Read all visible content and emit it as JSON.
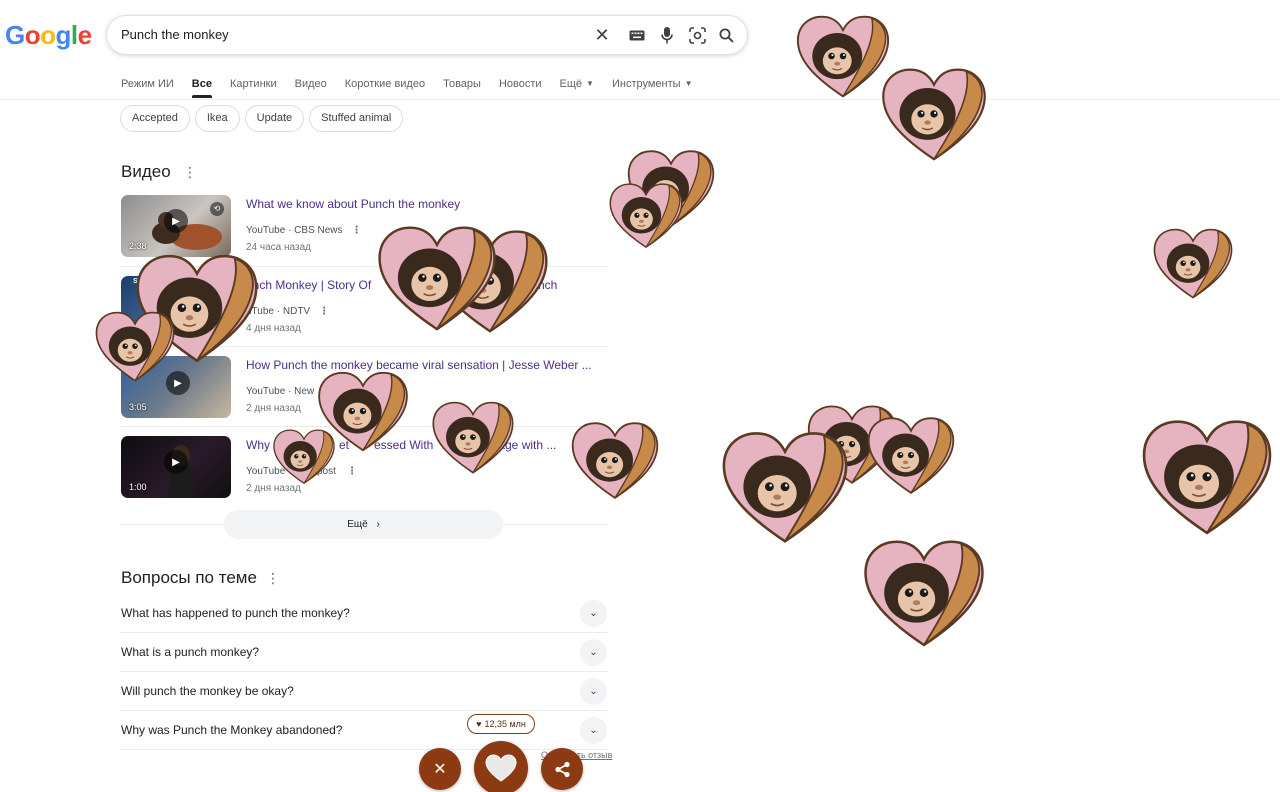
{
  "logo": {
    "letters": [
      "G",
      "o",
      "o",
      "g",
      "l",
      "e"
    ],
    "colors": [
      "#4285F4",
      "#EA4335",
      "#FBBC05",
      "#4285F4",
      "#34A853",
      "#EA4335"
    ]
  },
  "search": {
    "query": "Punch the monkey"
  },
  "tabs": [
    {
      "label": "Режим ИИ"
    },
    {
      "label": "Все"
    },
    {
      "label": "Картинки"
    },
    {
      "label": "Видео"
    },
    {
      "label": "Короткие видео"
    },
    {
      "label": "Товары"
    },
    {
      "label": "Новости"
    },
    {
      "label": "Ещё"
    },
    {
      "label": "Инструменты"
    }
  ],
  "chips": [
    "Accepted",
    "Ikea",
    "Update",
    "Stuffed animal"
  ],
  "videos_section": {
    "title": "Видео",
    "items": [
      {
        "title": "What we know about Punch the monkey",
        "source": "YouTube · CBS News",
        "date": "24 часа назад",
        "duration": "2:38"
      },
      {
        "title": "unch Monkey | Story Of",
        "title_tail": "nch",
        "source": "uTube · NDTV",
        "date": "4 дня назад",
        "duration": "",
        "badge": "STOR"
      },
      {
        "title": "How Punch the monkey became viral sensation | Jesse Weber ...",
        "source": "YouTube · New",
        "date": "2 дня назад",
        "duration": "3:05"
      },
      {
        "title": "Why",
        "title_mid": "et",
        "title_mid2": "essed With",
        "title_tail": "stage with ...",
        "source": "YouTube",
        "source_tail": "post",
        "date": "2 дня назад",
        "duration": "1:00"
      }
    ],
    "more_label": "Ещё"
  },
  "questions_section": {
    "title": "Вопросы по теме",
    "items": [
      "What has happened to punch the monkey?",
      "What is a punch monkey?",
      "Will punch the monkey be okay?",
      "Why was Punch the Monkey abandoned?"
    ],
    "feedback": "Отправить отзыв"
  },
  "widget": {
    "count": "12,35 млн"
  },
  "colors": {
    "accent_brown": "#8b3a12",
    "link_purple": "#4c2e8c",
    "heart_pink": "#e8b8c6"
  }
}
